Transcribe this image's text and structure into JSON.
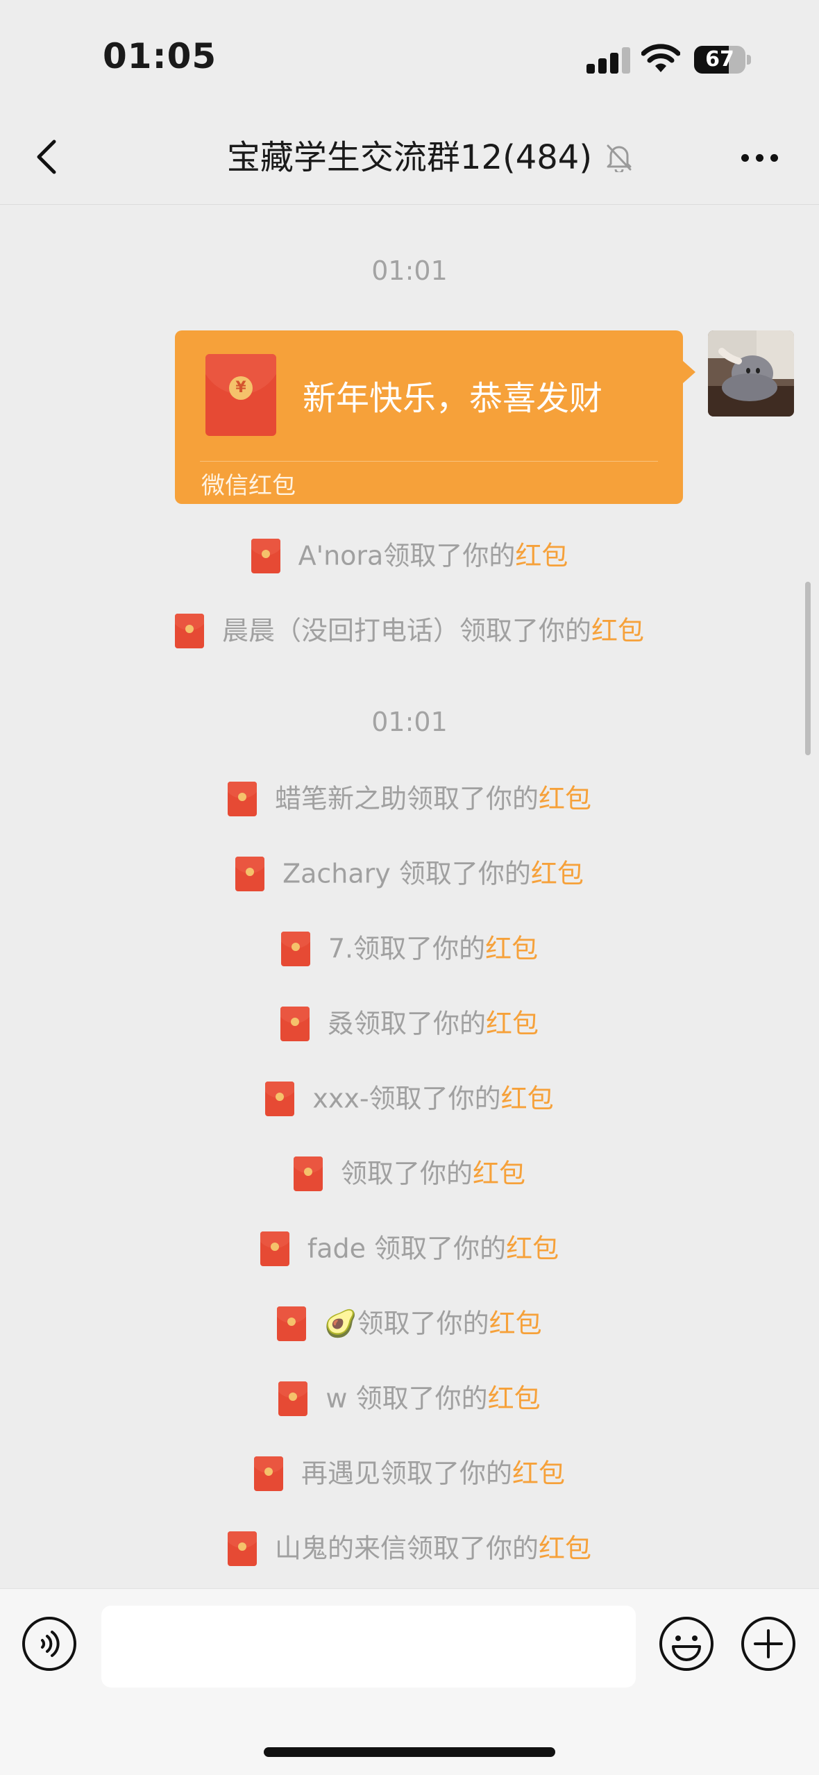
{
  "status_bar": {
    "time": "01:05",
    "battery": "67",
    "battery_level": 0.67
  },
  "header": {
    "title": "宝藏学生交流群12(484)"
  },
  "chat": {
    "timestamps": [
      "01:01",
      "01:01"
    ],
    "red_packet_message": {
      "greeting": "新年快乐，恭喜发财",
      "label": "微信红包",
      "currency_symbol": "¥"
    },
    "claims_group1": [
      {
        "name": "A'nora",
        "action": "领取了你的",
        "highlight": "红包"
      },
      {
        "name": "晨晨（没回打电话）",
        "action": "领取了你的",
        "highlight": "红包"
      }
    ],
    "claims_group2": [
      {
        "name": "蜡笔新之助",
        "action": "领取了你的",
        "highlight": "红包"
      },
      {
        "name": "Zachary ",
        "action": "领取了你的",
        "highlight": "红包"
      },
      {
        "name": "7.",
        "action": "领取了你的",
        "highlight": "红包"
      },
      {
        "name": "叒",
        "action": "领取了你的",
        "highlight": "红包"
      },
      {
        "name": "xxx-",
        "action": "领取了你的",
        "highlight": "红包"
      },
      {
        "name": "",
        "action": "领取了你的",
        "highlight": "红包"
      },
      {
        "name": "fade ",
        "action": "领取了你的",
        "highlight": "红包"
      },
      {
        "name": "🥑",
        "action": "领取了你的",
        "highlight": "红包"
      },
      {
        "name": "w ",
        "action": "领取了你的",
        "highlight": "红包"
      },
      {
        "name": "再遇见",
        "action": "领取了你的",
        "highlight": "红包"
      },
      {
        "name": "山鬼的来信",
        "action": "领取了你的",
        "highlight": "红包"
      }
    ]
  },
  "input_bar": {
    "placeholder": ""
  },
  "colors": {
    "accent": "#f6a13a",
    "red_packet": "#e64a34",
    "background": "#ededed"
  },
  "icons": [
    "back-icon",
    "mute-bell-icon",
    "more-icon",
    "voice-icon",
    "emoji-icon",
    "plus-icon"
  ]
}
